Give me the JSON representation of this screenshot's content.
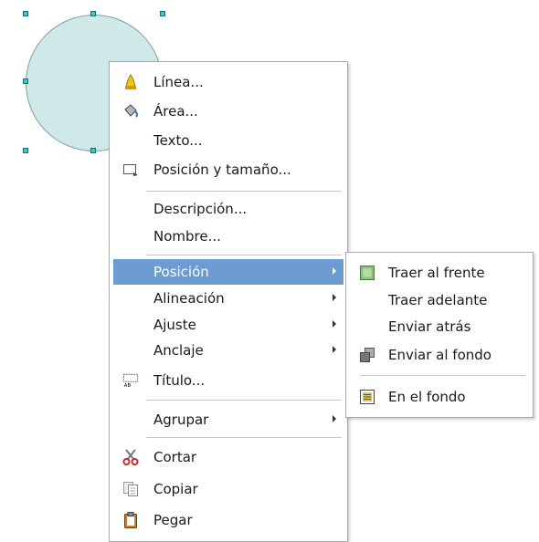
{
  "menu": {
    "items": [
      {
        "label": "Línea...",
        "icon": "line-icon"
      },
      {
        "label": "Área...",
        "icon": "area-icon"
      },
      {
        "label": "Texto..."
      },
      {
        "label": "Posición y tamaño...",
        "icon": "position-size-icon"
      },
      {
        "label": "Descripción..."
      },
      {
        "label": "Nombre..."
      },
      {
        "label": "Posición",
        "highlighted": true,
        "submenu": true
      },
      {
        "label": "Alineación",
        "submenu": true
      },
      {
        "label": "Ajuste",
        "submenu": true
      },
      {
        "label": "Anclaje",
        "submenu": true
      },
      {
        "label": "Título...",
        "icon": "caption-icon"
      },
      {
        "label": "Agrupar",
        "submenu": true
      },
      {
        "label": "Cortar",
        "icon": "scissors-icon"
      },
      {
        "label": "Copiar",
        "icon": "copy-icon"
      },
      {
        "label": "Pegar",
        "icon": "paste-icon"
      }
    ]
  },
  "submenu": {
    "items": [
      {
        "label": "Traer al frente",
        "icon": "bring-to-front-icon"
      },
      {
        "label": "Traer adelante"
      },
      {
        "label": "Enviar atrás"
      },
      {
        "label": "Enviar al fondo",
        "icon": "send-to-back-icon"
      },
      {
        "label": "En el fondo",
        "icon": "to-background-icon"
      }
    ]
  },
  "colors": {
    "highlight": "#6e9bd1",
    "shape_fill": "#cfe8e8",
    "handle": "#33cccc"
  }
}
